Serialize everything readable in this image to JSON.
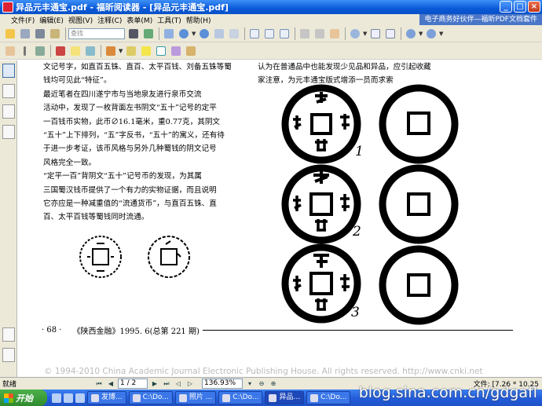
{
  "window": {
    "title": "异品元丰通宝.pdf - 福昕阅读器 - [异品元丰通宝.pdf]",
    "minimize": "_",
    "maximize": "□",
    "close": "×"
  },
  "menu": {
    "items": [
      "文件(F)",
      "编辑(E)",
      "视图(V)",
      "注释(C)",
      "表单(M)",
      "工具(T)",
      "帮助(H)"
    ],
    "ad_text": "电子商务好伙伴—福昕PDF文档套件"
  },
  "toolbar": {
    "search_placeholder": "查找"
  },
  "document": {
    "left_lines": [
      "文记号字，如直百五铢、直百、太平百钱、刘备五铢等蜀",
      "钱均可见此“特征”。",
      "    最近笔者在四川遂宁市与当地泉友进行泉币交流",
      "活动中，发现了一枚背面左书阴文“五十”记号的定平",
      "一百钱币实物，此币∅16.1毫米，重0.77克，其阴文",
      "“五十”上下排列，“五”字反书，“五十”的寓义，还有待",
      "于进一步考证，该币风格与另外几种蜀钱的阴文记号",
      "风格完全一致。",
      "    “定平一百”背阴文“五十”记号币的发现，为其属",
      "三国蜀汉钱币提供了一个有力的实物证据，而且说明",
      "它亦应是一种减重值的“流通货币”，与直百五铢、直",
      "百、太平百钱等蜀钱同时流通。"
    ],
    "right_lines": [
      "认为在普通品中也能发现少见品和异品，应引起收藏",
      "家注意，为元丰通宝版式增添一员而求索"
    ],
    "coin_labels": [
      "1",
      "2",
      "3"
    ],
    "footer_page": "· 68 ·",
    "footer_journal": "《陕西金融》1995. 6(总第 221 期)",
    "copyright": "© 1994-2010 China Academic Journal Electronic Publishing House. All rights reserved.    http://www.cnki.net"
  },
  "statusbar": {
    "ready": "就绪",
    "page_value": "1 / 2",
    "zoom_value": "136.93%",
    "dims": "文件: [7.26 * 10.25"
  },
  "taskbar": {
    "start": "开始",
    "tasks": [
      "发博...",
      "C:\\Do...",
      "照片 ...",
      "C:\\Do...",
      "异品...",
      "C:\\Do..."
    ],
    "watermark": "blog.sina.com.cn/gdgafl"
  },
  "colors": {
    "titlebar": "#0a5ad8",
    "taskbar": "#245edb",
    "start": "#2f8a2e"
  }
}
